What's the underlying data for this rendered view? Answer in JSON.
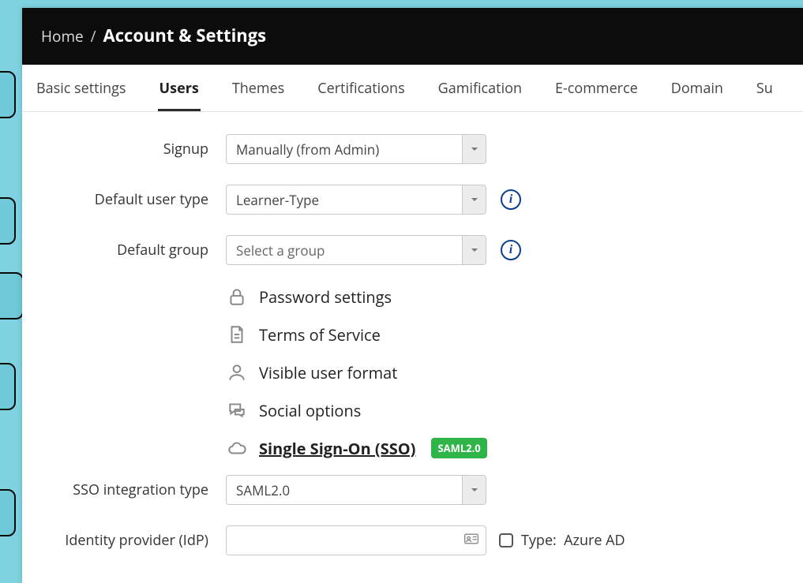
{
  "breadcrumb": {
    "home": "Home",
    "sep": "/",
    "current": "Account & Settings"
  },
  "tabs": [
    {
      "label": "Basic settings"
    },
    {
      "label": "Users"
    },
    {
      "label": "Themes"
    },
    {
      "label": "Certifications"
    },
    {
      "label": "Gamification"
    },
    {
      "label": "E-commerce"
    },
    {
      "label": "Domain"
    },
    {
      "label": "Su"
    }
  ],
  "form": {
    "signup": {
      "label": "Signup",
      "value": "Manually (from Admin)"
    },
    "default_user_type": {
      "label": "Default user type",
      "value": "Learner-Type"
    },
    "default_group": {
      "label": "Default group",
      "placeholder": "Select a group"
    },
    "sso_type": {
      "label": "SSO integration type",
      "value": "SAML2.0"
    },
    "idp": {
      "label": "Identity provider (IdP)",
      "value": "",
      "type_label": "Type:",
      "type_value": "Azure AD"
    }
  },
  "links": {
    "password": "Password settings",
    "tos": "Terms of Service",
    "userformat": "Visible user format",
    "social": "Social options",
    "sso": "Single Sign-On (SSO)",
    "sso_badge": "SAML2.0"
  }
}
